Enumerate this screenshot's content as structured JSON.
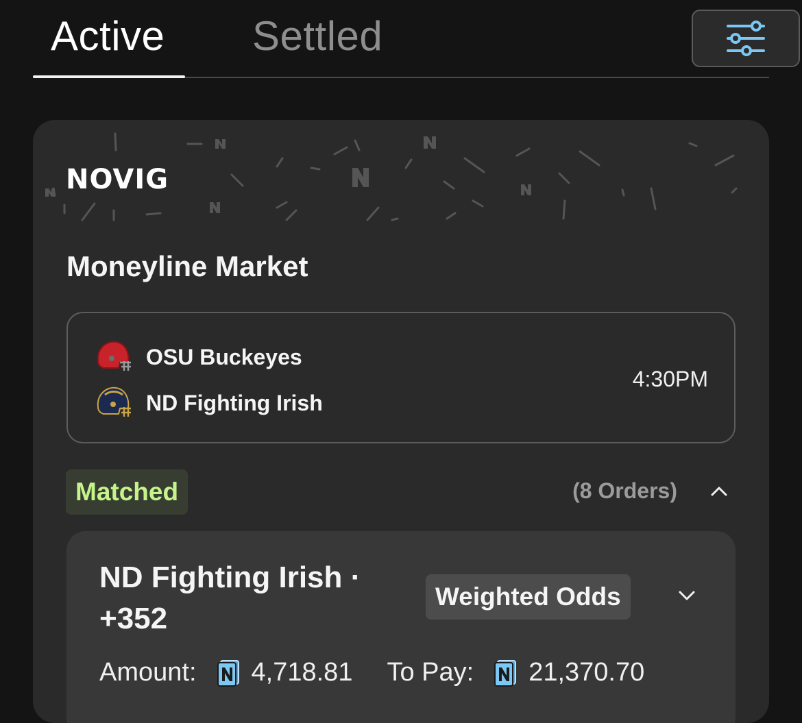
{
  "tabs": {
    "active": "Active",
    "settled": "Settled"
  },
  "filter": {
    "icon": "sliders-icon",
    "accent": "#7cc8f5"
  },
  "card": {
    "brand": "NOVIG",
    "market_title": "Moneyline Market",
    "matchup": {
      "teams": [
        {
          "name": "OSU Buckeyes",
          "icon": "red-helmet-icon",
          "color": "#c8232a"
        },
        {
          "name": "ND Fighting Irish",
          "icon": "navy-helmet-icon",
          "color": "#1c2a4f"
        }
      ],
      "time": "4:30PM"
    },
    "status": {
      "label": "Matched",
      "color": "#c5f58a"
    },
    "orders_count": "(8 Orders)",
    "order": {
      "title": "ND Fighting Irish ·",
      "odds": "+352",
      "badge": "Weighted Odds",
      "amount_label": "Amount:",
      "amount_value": "4,718.81",
      "pay_label": "To Pay:",
      "pay_value": "21,370.70"
    }
  }
}
